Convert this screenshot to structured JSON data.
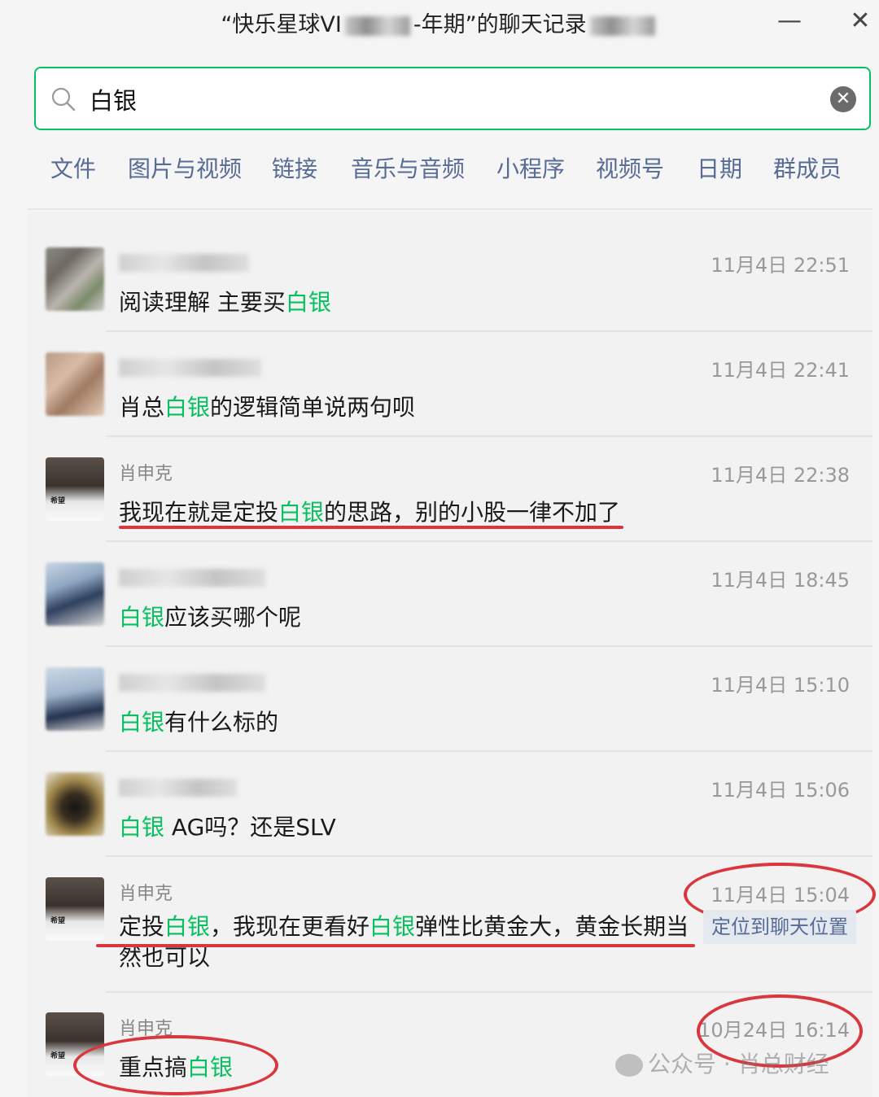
{
  "window": {
    "title_prefix": "“快乐星球VI",
    "title_middle": "-年期”的聊天记录",
    "minimize_glyph": "—",
    "close_glyph": "✕"
  },
  "search": {
    "value": "白银",
    "clear_glyph": "✕"
  },
  "filters": [
    "文件",
    "图片与视频",
    "链接",
    "音乐与音频",
    "小程序",
    "视频号",
    "日期",
    "群成员"
  ],
  "results": [
    {
      "sender": "",
      "time": "11月4日 22:51",
      "pre": "阅读理解 主要买",
      "hl": "白银",
      "post": ""
    },
    {
      "sender": "",
      "time": "11月4日 22:41",
      "pre": "肖总",
      "hl": "白银",
      "post": "的逻辑简单说两句呗"
    },
    {
      "sender": "肖申克",
      "time": "11月4日 22:38",
      "pre": "我现在就是定投",
      "hl": "白银",
      "post": "的思路，别的小股一律不加了"
    },
    {
      "sender": "",
      "time": "11月4日 18:45",
      "pre": "",
      "hl": "白银",
      "post": "应该买哪个呢"
    },
    {
      "sender": "",
      "time": "11月4日 15:10",
      "pre": "",
      "hl": "白银",
      "post": "有什么标的"
    },
    {
      "sender": "",
      "time": "11月4日 15:06",
      "pre": "",
      "hl": "白银",
      "post": " AG吗？还是SLV"
    },
    {
      "sender": "肖申克",
      "time": "11月4日 15:04",
      "locate": "定位到聊天位置",
      "parts": [
        "定投",
        "白银",
        "，我现在更看好",
        "白银",
        "弹性比黄金大，黄金长期当然也可以"
      ]
    },
    {
      "sender": "肖申克",
      "time": "10月24日 16:14",
      "pre": "重点搞",
      "hl": "白银",
      "post": ""
    }
  ],
  "avatar_photo_text": "希望",
  "watermark": "公众号 · 肖总财经",
  "colors": {
    "accent": "#07c160",
    "link": "#576b95",
    "annotation": "#d9363e"
  }
}
